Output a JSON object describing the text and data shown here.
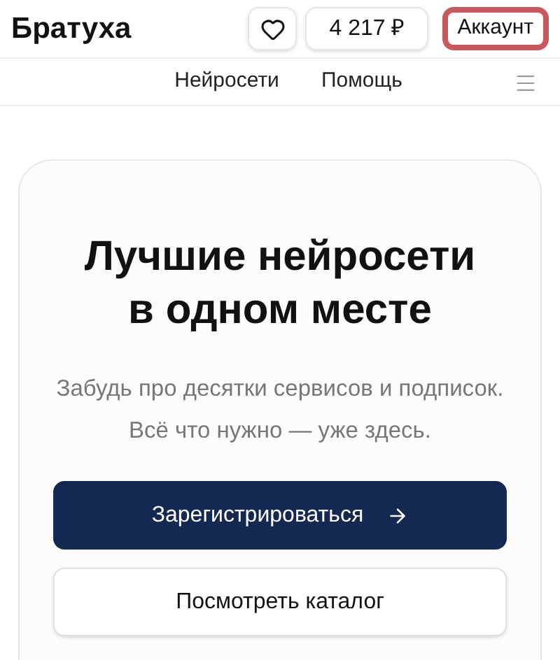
{
  "header": {
    "brand": "Братуха",
    "balance": "4 217 ₽",
    "account_button": {
      "label": "Аккаунт",
      "highlighted": true
    }
  },
  "nav": {
    "items": [
      "Нейросети",
      "Помощь"
    ]
  },
  "hero": {
    "title_lines": [
      "Лучшие нейросети",
      "в одном месте"
    ],
    "subtitle": "Забудь про десятки сервисов и подписок. Всё что нужно — уже здесь.",
    "primary_button": "Зарегистрироваться",
    "secondary_button": "Посмотреть каталог"
  }
}
